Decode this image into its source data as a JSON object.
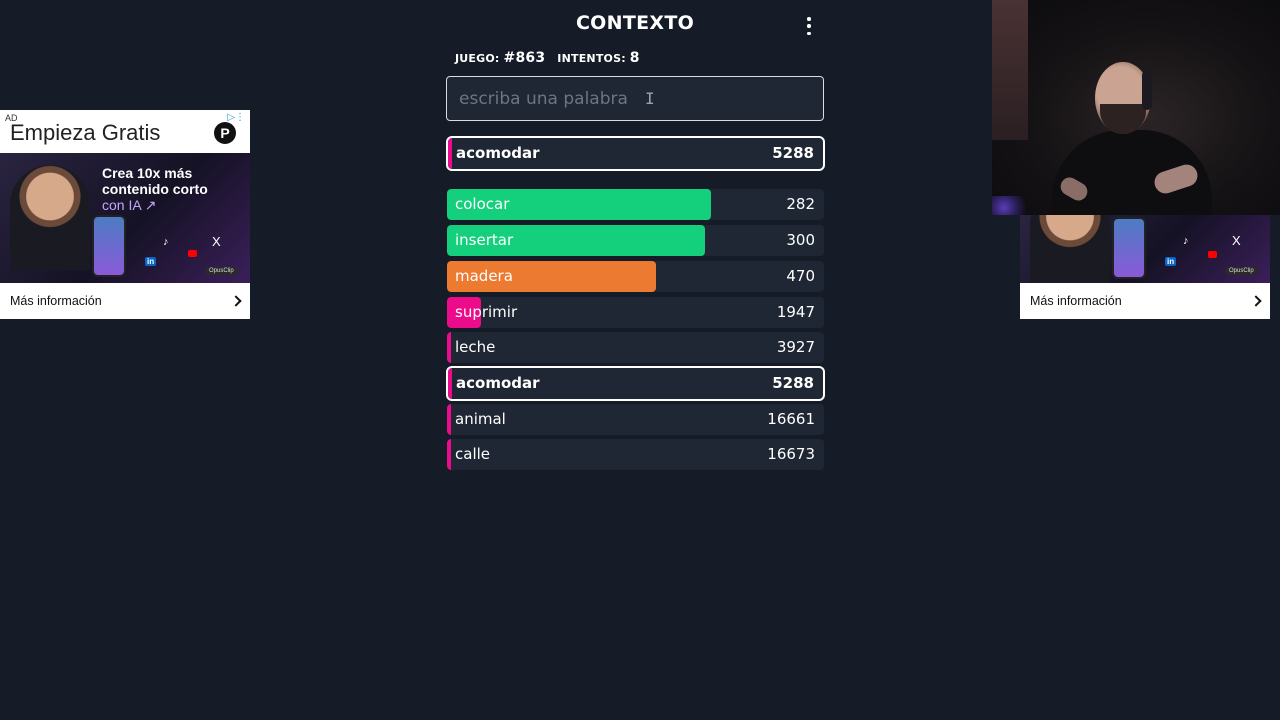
{
  "header": {
    "title": "CONTEXTO",
    "menu_icon": "kebab-menu-icon",
    "game_label": "JUEGO:",
    "game_number": "#863",
    "attempts_label": "INTENTOS:",
    "attempts_value": "8"
  },
  "search": {
    "placeholder": "escriba una palabra",
    "value": ""
  },
  "current_guess": {
    "word": "acomodar",
    "rank": "5288"
  },
  "colors": {
    "green": "#14cf7c",
    "orange": "#ec7a31",
    "pink": "#ec0b8b",
    "row_background": "#1e2733",
    "page_background": "#151c27"
  },
  "guesses": [
    {
      "word": "colocar",
      "rank": "282",
      "color": "#14cf7c",
      "closeness": 0.7,
      "highlighted": false
    },
    {
      "word": "insertar",
      "rank": "300",
      "color": "#14cf7c",
      "closeness": 0.685,
      "highlighted": false
    },
    {
      "word": "madera",
      "rank": "470",
      "color": "#ec7a31",
      "closeness": 0.555,
      "highlighted": false
    },
    {
      "word": "suprimir",
      "rank": "1947",
      "color": "#ec0b8b",
      "closeness": 0.09,
      "highlighted": false
    },
    {
      "word": "leche",
      "rank": "3927",
      "color": "#ec0b8b",
      "closeness": 0.01,
      "highlighted": false
    },
    {
      "word": "acomodar",
      "rank": "5288",
      "color": "#ec0b8b",
      "closeness": 0.005,
      "highlighted": true
    },
    {
      "word": "animal",
      "rank": "16661",
      "color": "#ec0b8b",
      "closeness": 0.005,
      "highlighted": false
    },
    {
      "word": "calle",
      "rank": "16673",
      "color": "#ec0b8b",
      "closeness": 0.005,
      "highlighted": false
    }
  ],
  "ad_left": {
    "label": "AD",
    "headline": "Empieza Gratis",
    "promo_line1": "Crea 10x más",
    "promo_line2": "contenido corto",
    "promo_line3": "con IA ↗",
    "brand": "OpusClip",
    "cta": "Más información"
  },
  "ad_right": {
    "brand": "OpusClip",
    "cta": "Más información"
  }
}
